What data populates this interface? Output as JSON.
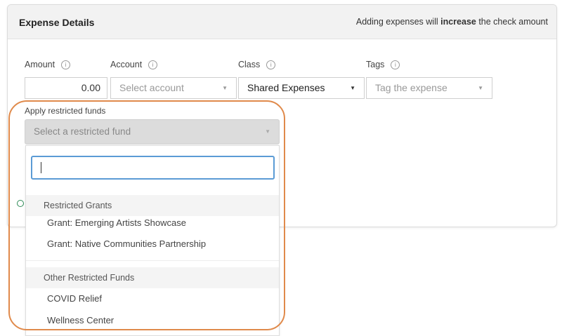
{
  "panel": {
    "title": "Expense Details",
    "note_prefix": "Adding expenses will ",
    "note_emphasis": "increase",
    "note_suffix": " the check amount"
  },
  "fields": {
    "amount_label": "Amount",
    "account_label": "Account",
    "class_label": "Class",
    "tags_label": "Tags",
    "amount_value": "0.00",
    "account_placeholder": "Select account",
    "class_value": "Shared Expenses",
    "tags_placeholder": "Tag the expense"
  },
  "restricted": {
    "label": "Apply restricted funds",
    "placeholder": "Select a restricted fund",
    "search_value": ""
  },
  "dropdown": {
    "groups": [
      {
        "label": "Restricted Grants",
        "options": [
          "Grant: Emerging Artists Showcase",
          "Grant: Native Communities Partnership"
        ]
      },
      {
        "label": "Other Restricted Funds",
        "options": [
          "COVID Relief",
          "Wellness Center"
        ]
      }
    ]
  },
  "colors": {
    "highlight": "#e08a4b",
    "focus": "#5b9bd5"
  },
  "icons": {
    "info": "info-circle-icon",
    "caret": "caret-down-icon"
  }
}
